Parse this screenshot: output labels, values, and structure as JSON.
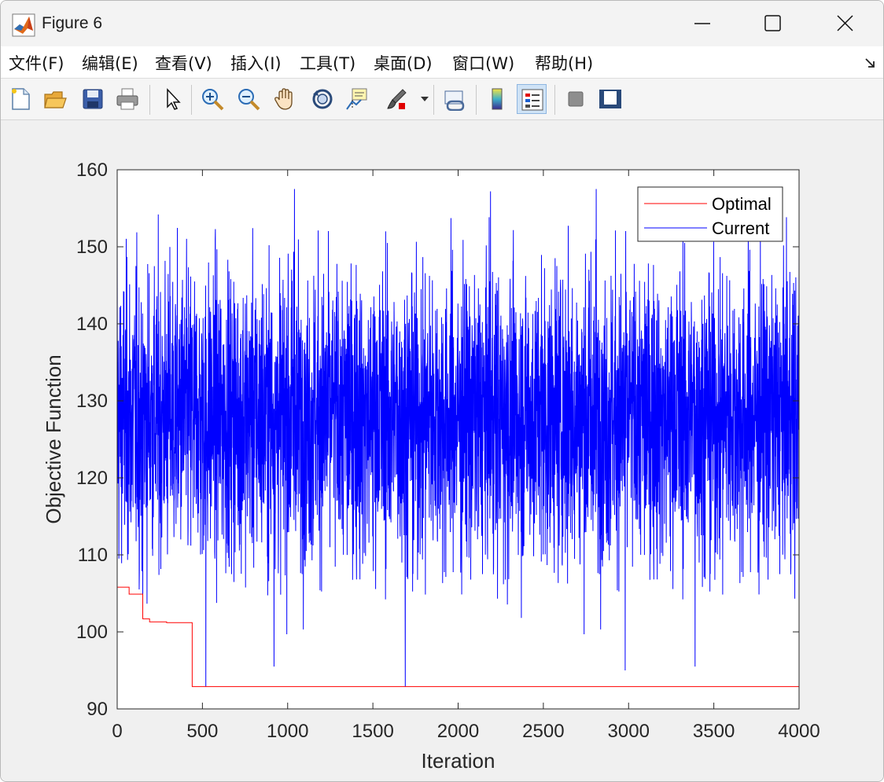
{
  "window": {
    "title": "Figure 6",
    "icon": "matlab-logo-icon"
  },
  "menubar": {
    "items": [
      "文件(F)",
      "编辑(E)",
      "查看(V)",
      "插入(I)",
      "工具(T)",
      "桌面(D)",
      "窗口(W)",
      "帮助(H)"
    ],
    "more_icon": "expand-arrow-icon"
  },
  "toolbar": {
    "buttons": [
      "new-figure-icon",
      "open-file-icon",
      "save-icon",
      "print-icon",
      "pointer-icon",
      "zoom-in-icon",
      "zoom-out-icon",
      "pan-hand-icon",
      "rotate-3d-icon",
      "data-cursor-icon",
      "brush-icon",
      "link-plot-icon",
      "colorbar-icon",
      "legend-icon",
      "hide-plot-tools-icon",
      "show-plot-tools-icon"
    ],
    "active": "legend-icon"
  },
  "colors": {
    "optimal": "#ff0000",
    "current": "#0000ff",
    "axes_bg": "#ffffff",
    "figure_bg": "#f0f0f0"
  },
  "chart_data": {
    "type": "line",
    "xlabel": "Iteration",
    "ylabel": "Objective Function",
    "xlim": [
      0,
      4000
    ],
    "ylim": [
      90,
      160
    ],
    "xticks": [
      0,
      500,
      1000,
      1500,
      2000,
      2500,
      3000,
      3500,
      4000
    ],
    "yticks": [
      90,
      100,
      110,
      120,
      130,
      140,
      150,
      160
    ],
    "grid": false,
    "legend": {
      "position": "top-right",
      "entries": [
        "Optimal",
        "Current"
      ]
    },
    "series": [
      {
        "name": "Optimal",
        "color": "#ff0000",
        "step": true,
        "x": [
          0,
          70,
          150,
          190,
          290,
          440,
          4000
        ],
        "y": [
          105.8,
          104.9,
          101.7,
          101.3,
          101.2,
          92.9,
          92.9
        ]
      },
      {
        "name": "Current",
        "color": "#0000ff",
        "points": 4000,
        "mean": 128,
        "range": [
          92.9,
          157.5
        ],
        "typical_band": [
          103,
          155
        ],
        "notable_x": [
          0,
          150,
          520,
          920,
          1040,
          1690,
          2190,
          2810,
          2980,
          3390,
          4000
        ],
        "notable_y": [
          151.5,
          103.0,
          92.9,
          95.5,
          157.5,
          92.9,
          157.2,
          157.5,
          95.0,
          95.5,
          151.0
        ]
      }
    ]
  }
}
